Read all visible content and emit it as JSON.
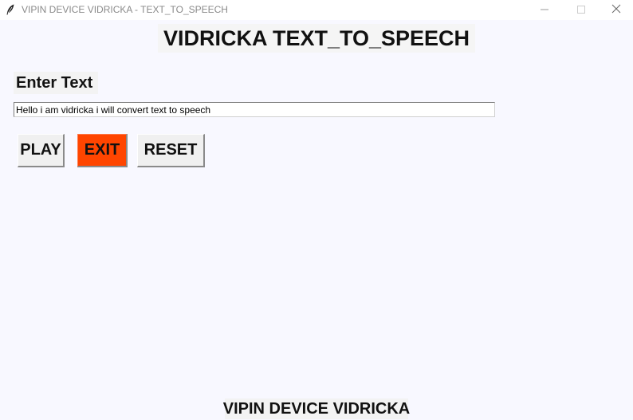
{
  "window": {
    "title": "VIPIN DEVICE VIDRICKA - TEXT_TO_SPEECH",
    "app_icon": "feather-icon",
    "controls": [
      "minimize-icon",
      "maximize-icon",
      "close-icon"
    ]
  },
  "main": {
    "heading": "VIDRICKA TEXT_TO_SPEECH",
    "input_label": "Enter Text",
    "input_value": "Hello i am vidricka i will convert text to speech"
  },
  "buttons": {
    "play": "PLAY",
    "exit": "EXIT",
    "reset": "RESET"
  },
  "footer": {
    "text": "VIPIN DEVICE VIDRICKA"
  },
  "colors": {
    "background": "#f8f8ff",
    "exit_button": "#ff4500"
  }
}
